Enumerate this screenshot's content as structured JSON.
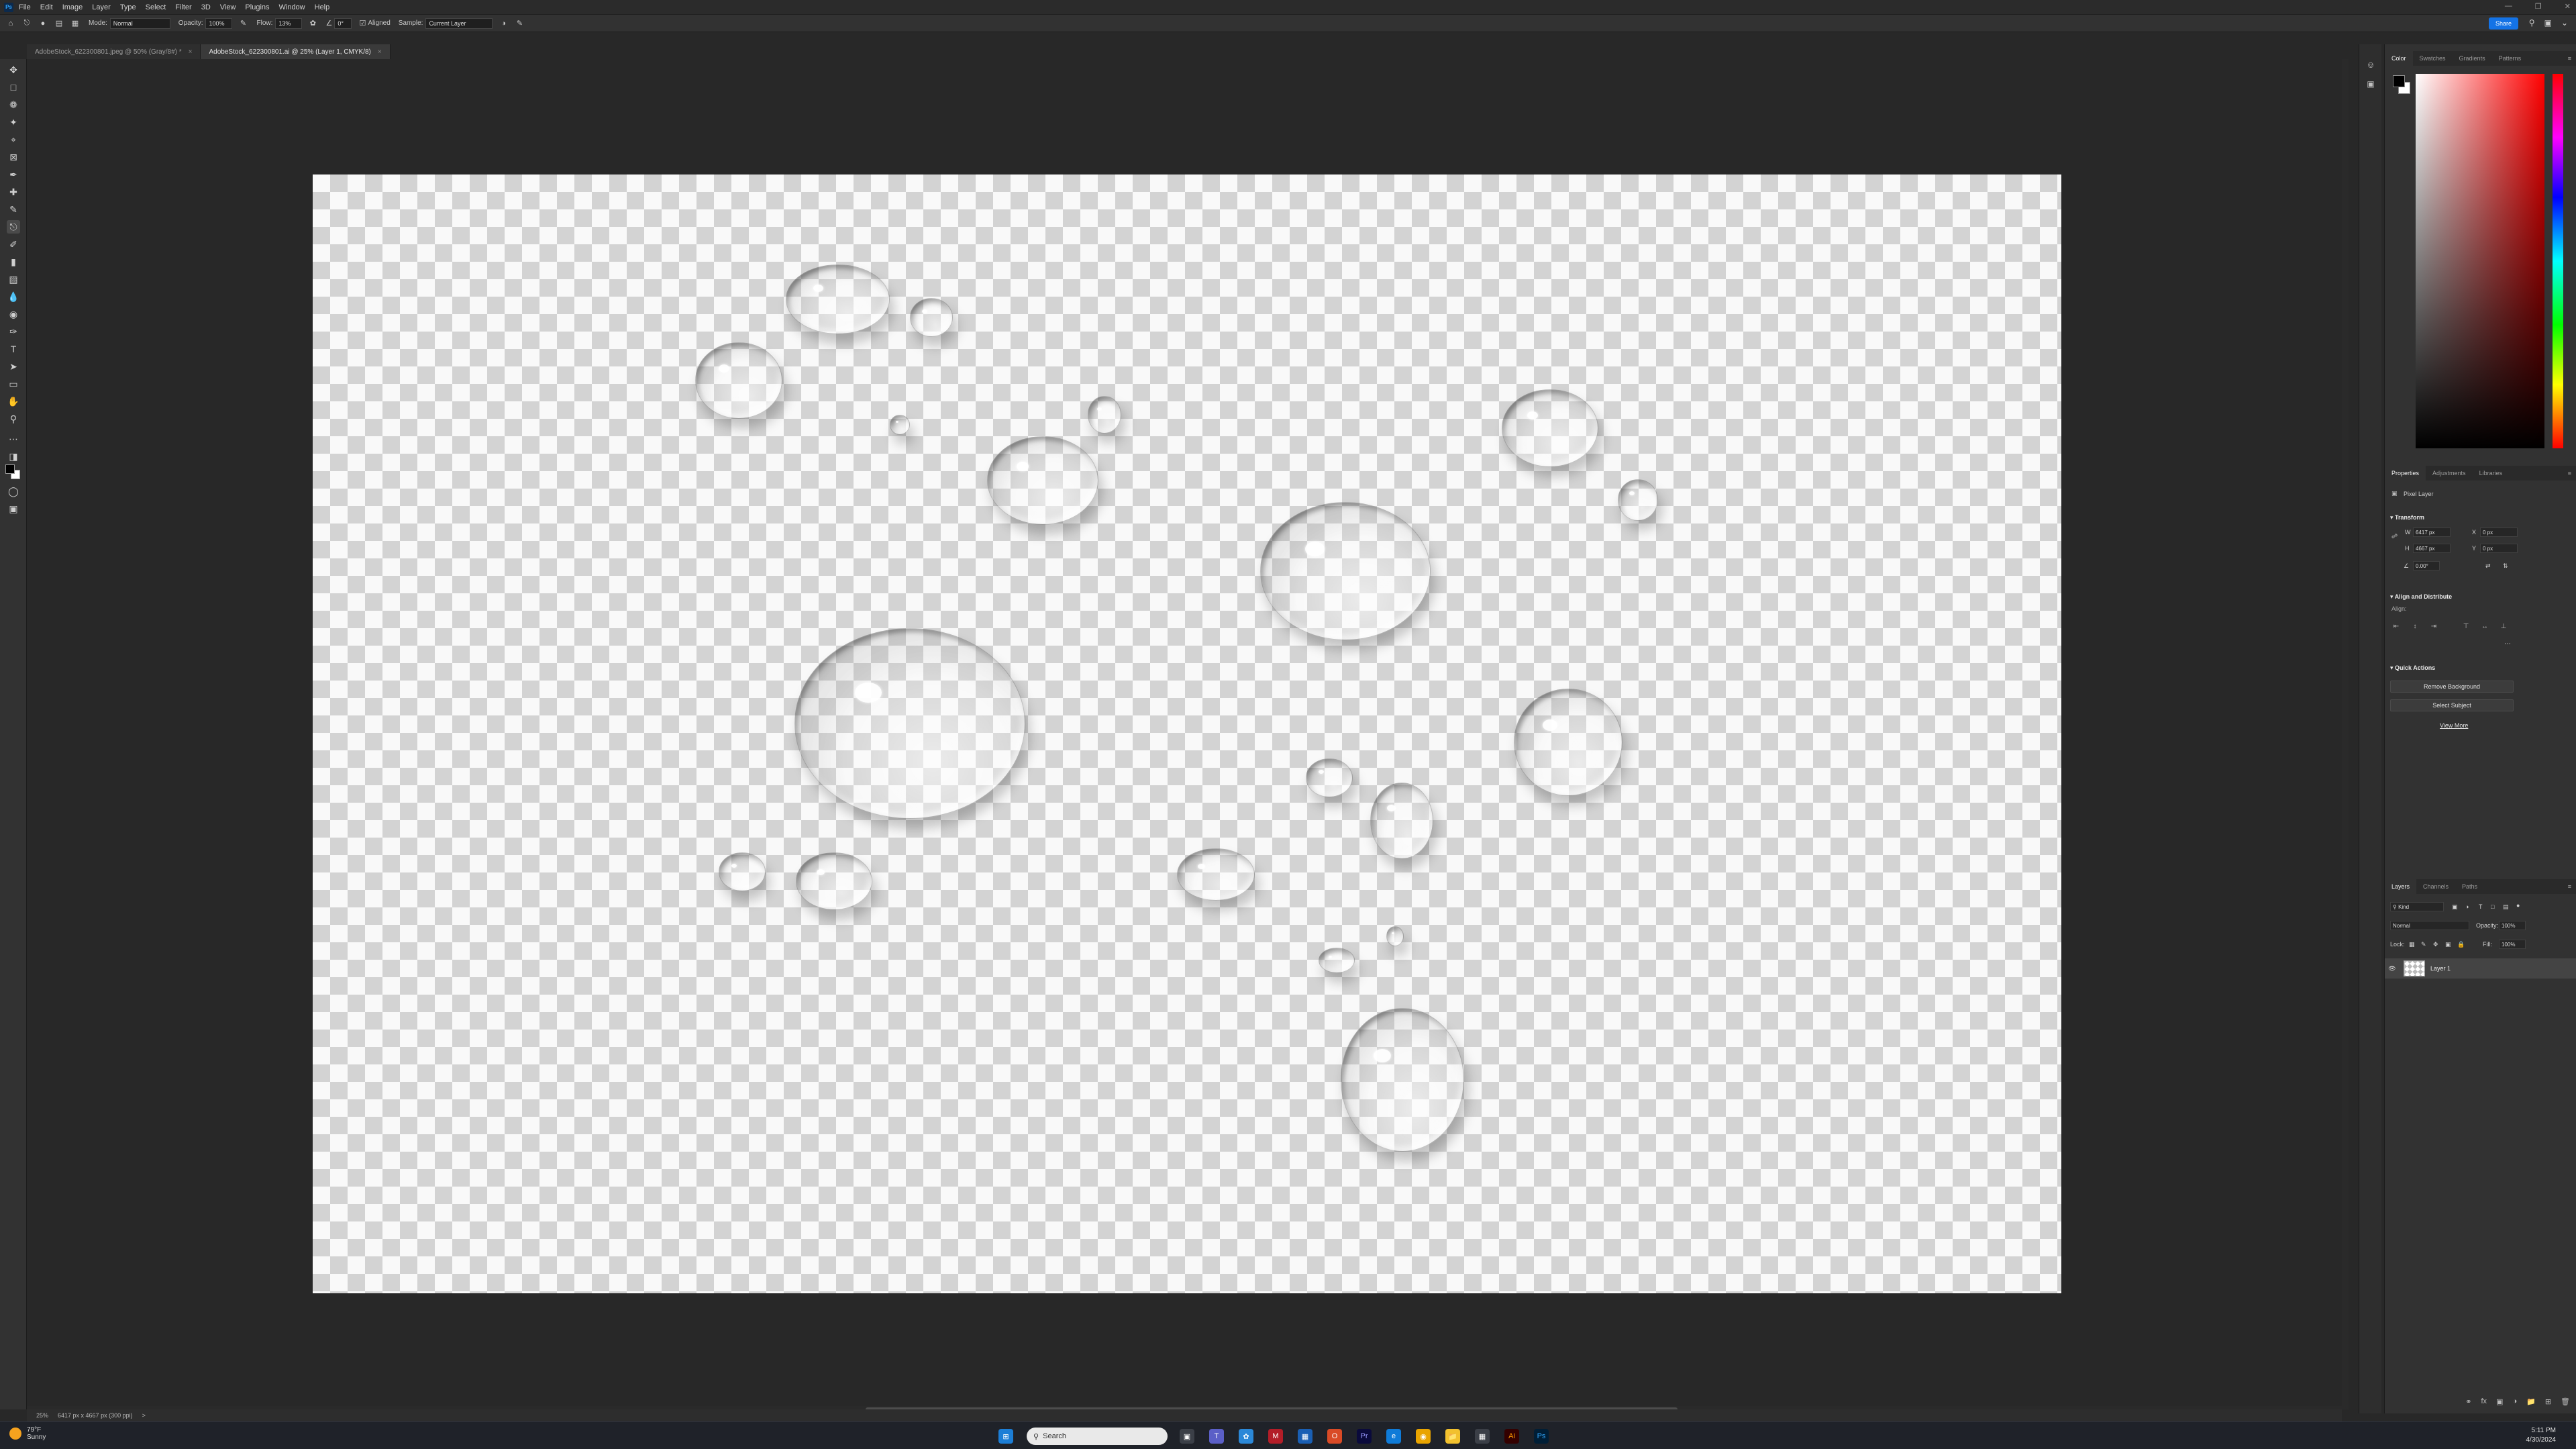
{
  "app": {
    "logo": "Ps"
  },
  "menu": [
    "File",
    "Edit",
    "Image",
    "Layer",
    "Type",
    "Select",
    "Filter",
    "3D",
    "View",
    "Plugins",
    "Window",
    "Help"
  ],
  "options_bar": {
    "mode_label": "Mode:",
    "mode_value": "Normal",
    "opacity_label": "Opacity:",
    "opacity_value": "100%",
    "flow_label": "Flow:",
    "flow_value": "13%",
    "angle_value": "0°",
    "aligned_label": "Aligned",
    "sample_label": "Sample:",
    "sample_value": "Current Layer",
    "share_label": "Share"
  },
  "tabs": [
    {
      "label": "AdobeStock_622300801.jpeg @ 50% (Gray/8#) *",
      "active": false
    },
    {
      "label": "AdobeStock_622300801.ai @ 25% (Layer 1, CMYK/8)",
      "active": true
    }
  ],
  "status": {
    "zoom": "25%",
    "dimensions": "6417 px x 4667 px (300 ppi)",
    "arrow": ">"
  },
  "color_panel": {
    "tabs": [
      "Color",
      "Swatches",
      "Gradients",
      "Patterns"
    ],
    "active": "Color",
    "foreground": "#000000",
    "background": "#ffffff"
  },
  "properties_panel": {
    "tabs": [
      "Properties",
      "Adjustments",
      "Libraries"
    ],
    "layer_type": "Pixel Layer",
    "transform_title": "Transform",
    "w_label": "W",
    "w_value": "6417 px",
    "h_label": "H",
    "h_value": "4667 px",
    "x_label": "X",
    "x_value": "0 px",
    "y_label": "Y",
    "y_value": "0 px",
    "angle_value": "0.00°",
    "align_title": "Align and Distribute",
    "align_label": "Align:",
    "quick_actions_title": "Quick Actions",
    "remove_bg_label": "Remove Background",
    "select_subject_label": "Select Subject",
    "view_more_label": "View More"
  },
  "layers_panel": {
    "tabs": [
      "Layers",
      "Channels",
      "Paths"
    ],
    "filter_kind": "Kind",
    "blend_mode": "Normal",
    "opacity_label": "Opacity:",
    "opacity_value": "100%",
    "lock_label": "Lock:",
    "fill_label": "Fill:",
    "fill_value": "100%",
    "layers": [
      {
        "name": "Layer 1",
        "visible": true
      }
    ]
  },
  "taskbar": {
    "weather_temp": "79°F",
    "weather_desc": "Sunny",
    "search_label": "Search",
    "time": "5:11 PM",
    "date": "4/30/2024"
  }
}
